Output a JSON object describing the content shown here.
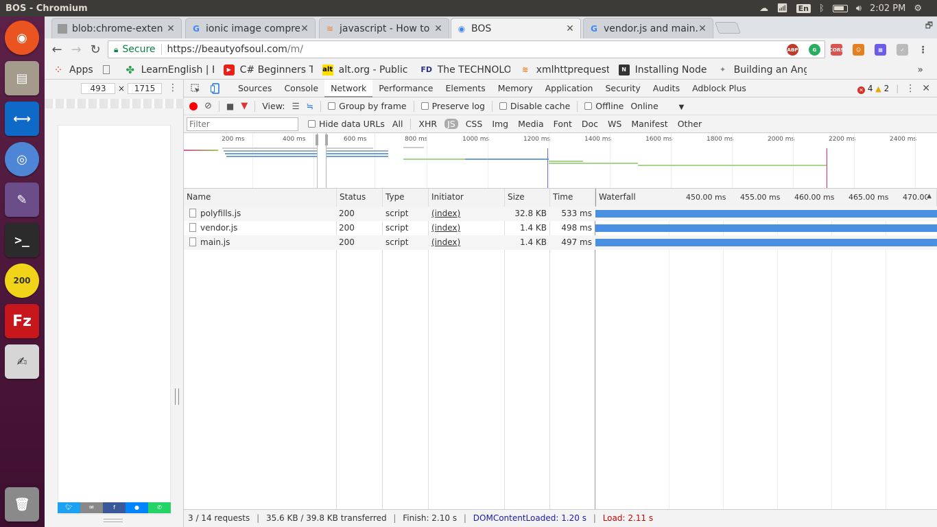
{
  "os": {
    "window_title": "BOS - Chromium",
    "keyboard": "En",
    "clock": "2:02 PM"
  },
  "tabs": [
    {
      "label": "blob:chrome-exten",
      "icon": "document-icon"
    },
    {
      "label": "ionic image compre",
      "icon": "google-icon"
    },
    {
      "label": "javascript - How to l",
      "icon": "stackoverflow-icon"
    },
    {
      "label": "BOS",
      "icon": "globe-icon",
      "active": true
    },
    {
      "label": "vendor.js and main.",
      "icon": "google-icon"
    }
  ],
  "address_bar": {
    "secure_label": "Secure",
    "url_host": "https://beautyofsoul.com",
    "url_path": "/m/"
  },
  "bookmarks": [
    {
      "label": "Apps",
      "icon": "apps-grid-icon"
    },
    {
      "label": "LearnEnglish | B",
      "icon": "clover-icon"
    },
    {
      "label": "C# Beginners Tu",
      "icon": "youtube-icon"
    },
    {
      "label": "alt.org - Public N",
      "icon": "alt-icon"
    },
    {
      "label": "The TECHNOLO",
      "icon": "fd-icon"
    },
    {
      "label": "xmlhttprequest",
      "icon": "stackoverflow-icon"
    },
    {
      "label": "Installing Node.",
      "icon": "nodejs-icon"
    },
    {
      "label": "Building an Ang",
      "icon": "angular-icon"
    }
  ],
  "device": {
    "width": "493",
    "height": "1715",
    "times": "×"
  },
  "devtools": {
    "tabs": [
      "Sources",
      "Console",
      "Network",
      "Performance",
      "Elements",
      "Memory",
      "Application",
      "Security",
      "Audits",
      "Adblock Plus"
    ],
    "active_tab": "Network",
    "errors": "4",
    "warnings": "2"
  },
  "network": {
    "view_label": "View:",
    "group_by_frame": "Group by frame",
    "preserve_log": "Preserve log",
    "disable_cache": "Disable cache",
    "offline": "Offline",
    "throttle": "Online",
    "filter_placeholder": "Filter",
    "hide_data_urls": "Hide data URLs",
    "filter_types": [
      "All",
      "XHR",
      "JS",
      "CSS",
      "Img",
      "Media",
      "Font",
      "Doc",
      "WS",
      "Manifest",
      "Other"
    ],
    "selected_type": "JS",
    "overview_ticks": [
      "200 ms",
      "400 ms",
      "600 ms",
      "800 ms",
      "1000 ms",
      "1200 ms",
      "1400 ms",
      "1600 ms",
      "1800 ms",
      "2000 ms",
      "2200 ms",
      "2400 ms"
    ],
    "columns": [
      "Name",
      "Status",
      "Type",
      "Initiator",
      "Size",
      "Time",
      "Waterfall"
    ],
    "waterfall_ticks": [
      "450.00 ms",
      "455.00 ms",
      "460.00 ms",
      "465.00 ms",
      "470.00"
    ],
    "rows": [
      {
        "name": "polyfills.js",
        "status": "200",
        "type": "script",
        "initiator": "(index)",
        "size": "32.8 KB",
        "time": "533 ms"
      },
      {
        "name": "vendor.js",
        "status": "200",
        "type": "script",
        "initiator": "(index)",
        "size": "1.4 KB",
        "time": "498 ms"
      },
      {
        "name": "main.js",
        "status": "200",
        "type": "script",
        "initiator": "(index)",
        "size": "1.4 KB",
        "time": "497 ms"
      }
    ],
    "status": {
      "requests": "3 / 14 requests",
      "transferred": "35.6 KB / 39.8 KB transferred",
      "finish": "Finish: 2.10 s",
      "dom_loaded": "DOMContentLoaded: 1.20 s",
      "load": "Load: 2.11 s"
    }
  },
  "colors": {
    "waterfall_bar": "#4a90e2",
    "dom_loaded": "#1a1aa6",
    "load": "#c80000",
    "launcher": "#5c2148"
  }
}
